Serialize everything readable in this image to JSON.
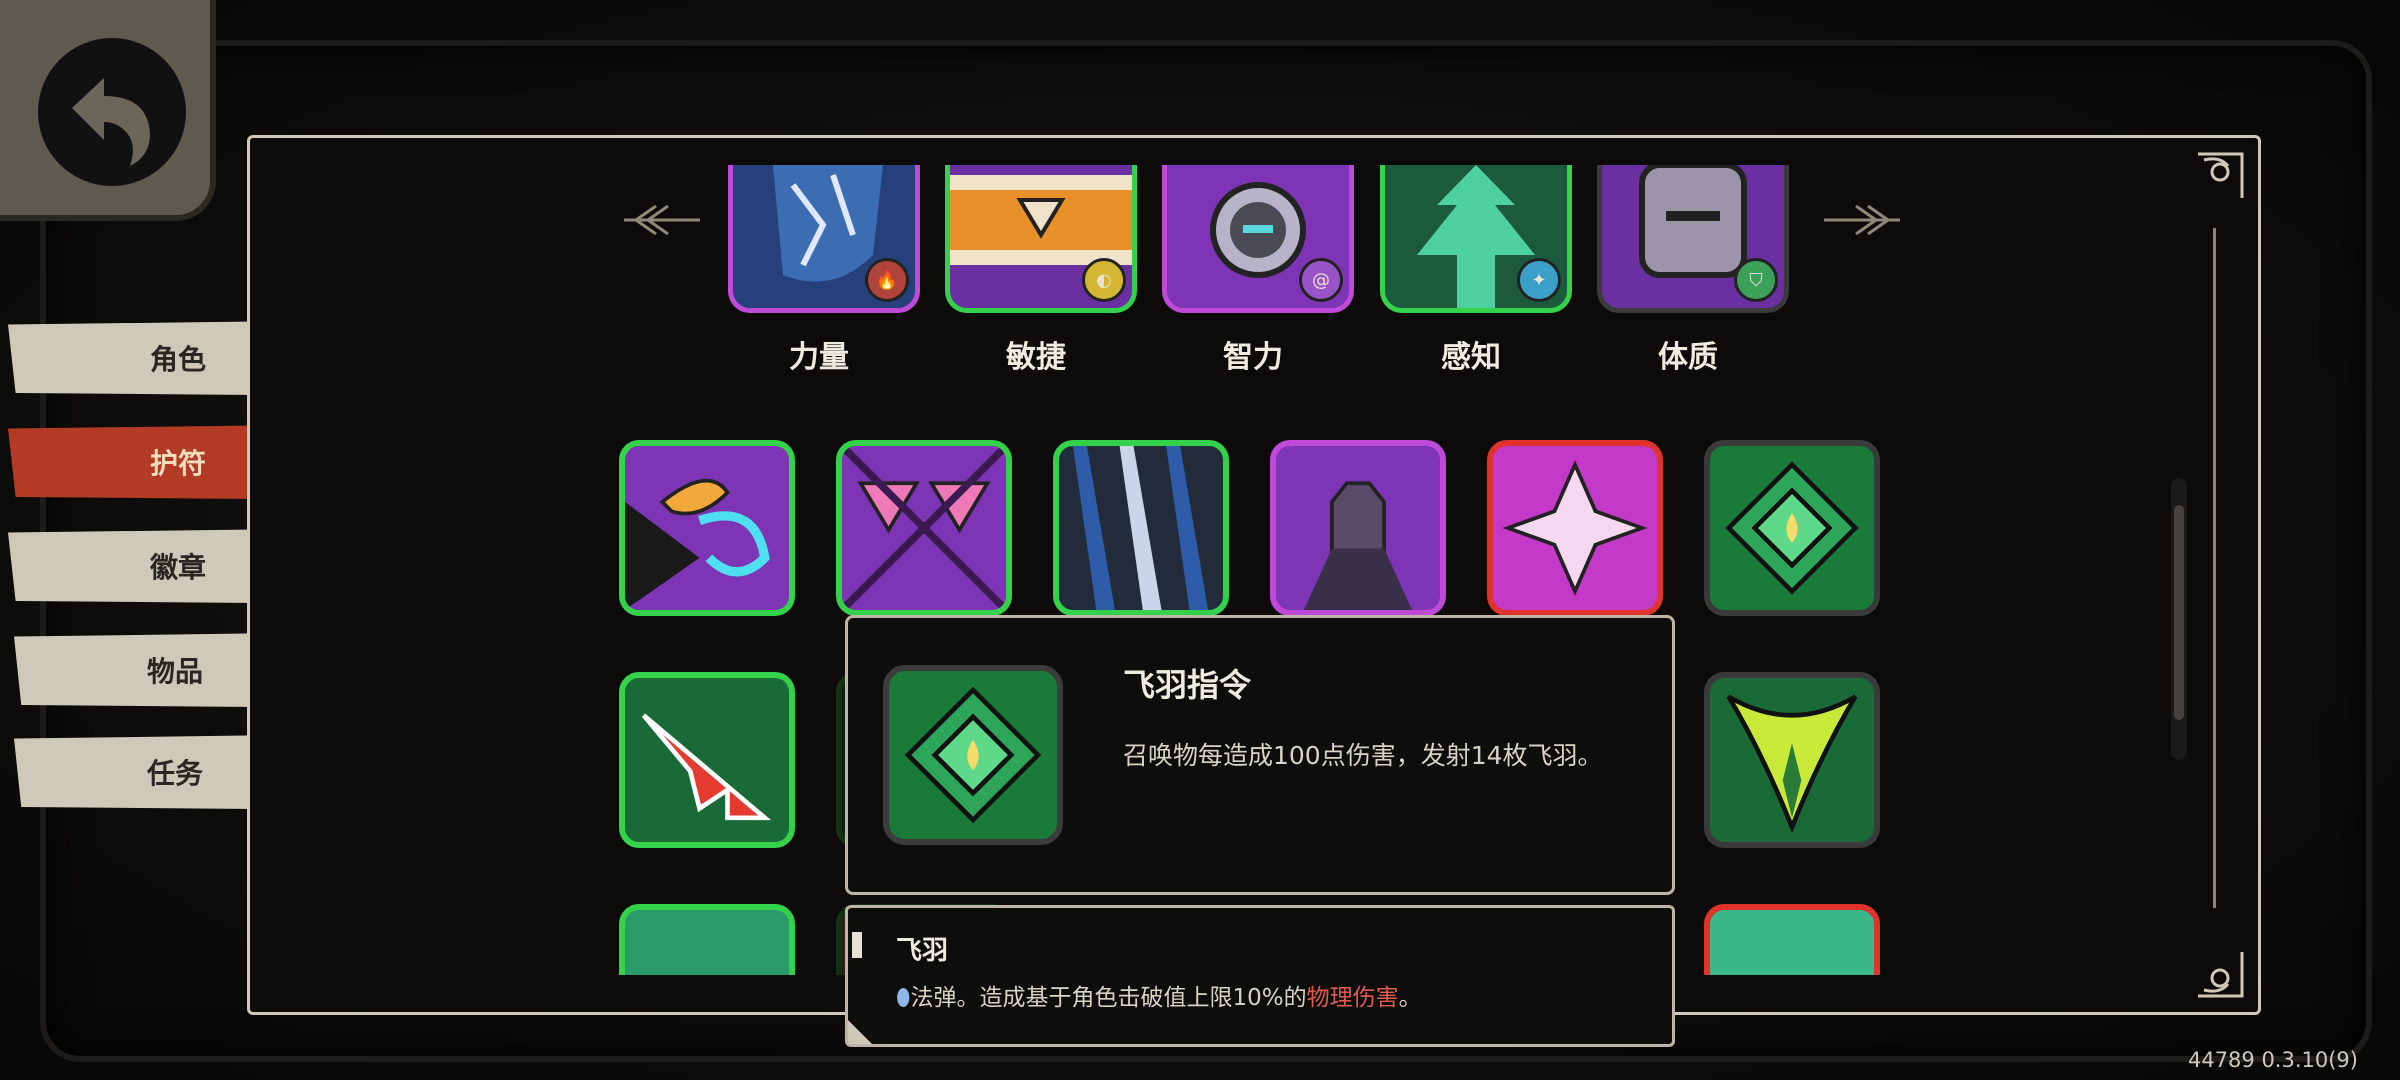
{
  "tabs": [
    {
      "label": "角色",
      "active": false
    },
    {
      "label": "护符",
      "active": true
    },
    {
      "label": "徽章",
      "active": false
    },
    {
      "label": "物品",
      "active": false
    },
    {
      "label": "任务",
      "active": false
    }
  ],
  "stats": [
    {
      "label": "力量",
      "icon": "fist-icon",
      "badge": "flame-icon",
      "border": "#c04ad8"
    },
    {
      "label": "敏捷",
      "icon": "scroll-icon",
      "badge": "crescent-icon",
      "border": "#34d14b"
    },
    {
      "label": "智力",
      "icon": "orb-icon",
      "badge": "swirl-icon",
      "border": "#c04ad8"
    },
    {
      "label": "感知",
      "icon": "tree-icon",
      "badge": "star-icon",
      "border": "#34d14b"
    },
    {
      "label": "体质",
      "icon": "armor-icon",
      "badge": "shield-icon",
      "border": "#3a3a3a"
    }
  ],
  "tooltip": {
    "title": "飞羽指令",
    "description": "召唤物每造成100点伤害，发射14枚飞羽。"
  },
  "subtooltip": {
    "title": "飞羽",
    "desc_prefix": "法弹。造成基于角色击破值上限10%的",
    "desc_highlight": "物理伤害",
    "desc_suffix": "。"
  },
  "version": "44789 0.3.10(9)",
  "colors": {
    "active_tab": "#b33a24",
    "rare_green": "#34d14b",
    "epic_purple": "#c04ad8",
    "legendary_red": "#e0332c",
    "damage_highlight": "#e05a52"
  }
}
